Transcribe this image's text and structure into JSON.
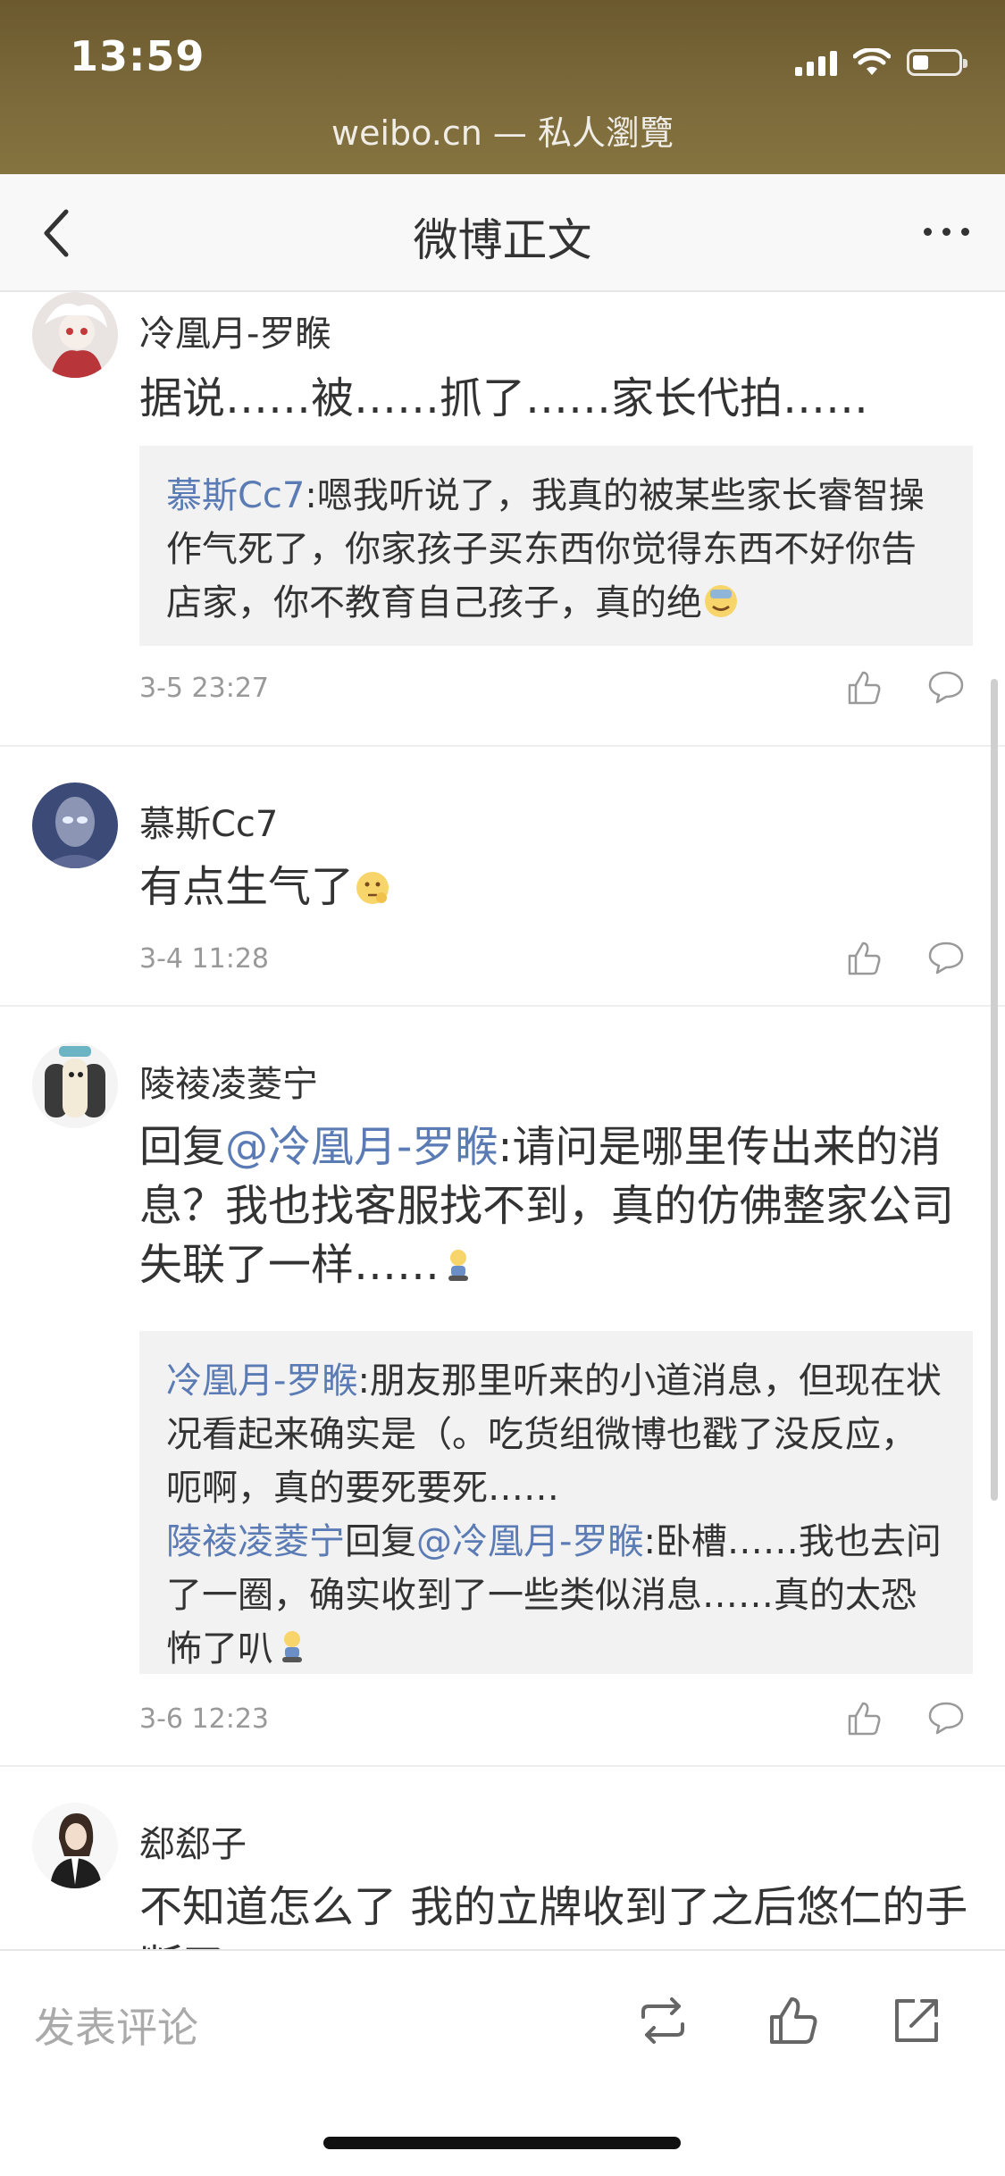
{
  "status_bar": {
    "time": "13:59",
    "url": "weibo.cn — 私人瀏覽",
    "battery_level": 0.35
  },
  "nav": {
    "title": "微博正文"
  },
  "comments": [
    {
      "user": "冷凰月-罗睺",
      "text": "据说……被……抓了……家长代拍……",
      "quote_lines": [
        {
          "name": "慕斯Cc7",
          "reply_to": "",
          "text": ":嗯我听说了，我真的被某些家长睿智操作气死了，你家孩子买东西你觉得东西不好你告店家，你不教育自己孩子，真的绝"
        }
      ],
      "time": "3-5 23:27"
    },
    {
      "user": "慕斯Cc7",
      "text": "有点生气了",
      "time": "3-4 11:28"
    },
    {
      "user": "陵祾凌菱宁",
      "reply_prefix": "回复",
      "reply_mention": "@冷凰月-罗睺",
      "text": ":请问是哪里传出来的消息？我也找客服找不到，真的仿佛整家公司失联了一样……",
      "quote_lines": [
        {
          "name": "冷凰月-罗睺",
          "text": ":朋友那里听来的小道消息，但现在状况看起来确实是（。吃货组微博也戳了没反应，呃啊，真的要死要死……"
        },
        {
          "name": "陵祾凌菱宁",
          "reply_word": "回复",
          "reply_to": "@冷凰月-罗睺",
          "text": ":卧槽……我也去问了一圈，确实收到了一些类似消息……真的太恐怖了叭"
        }
      ],
      "time": "3-6 12:23"
    },
    {
      "user": "郄郄子",
      "text": "不知道怎么了 我的立牌收到了之后悠仁的手断了"
    }
  ],
  "toolbar": {
    "input_placeholder": "发表评论"
  },
  "colors": {
    "mention": "#5b7bb5",
    "status_bar": "#7d6b3c",
    "quote_bg": "#f2f2f2"
  },
  "icons": [
    "back-chevron-icon",
    "more-dots-icon",
    "like-icon",
    "comment-icon",
    "repost-icon",
    "share-icon"
  ]
}
